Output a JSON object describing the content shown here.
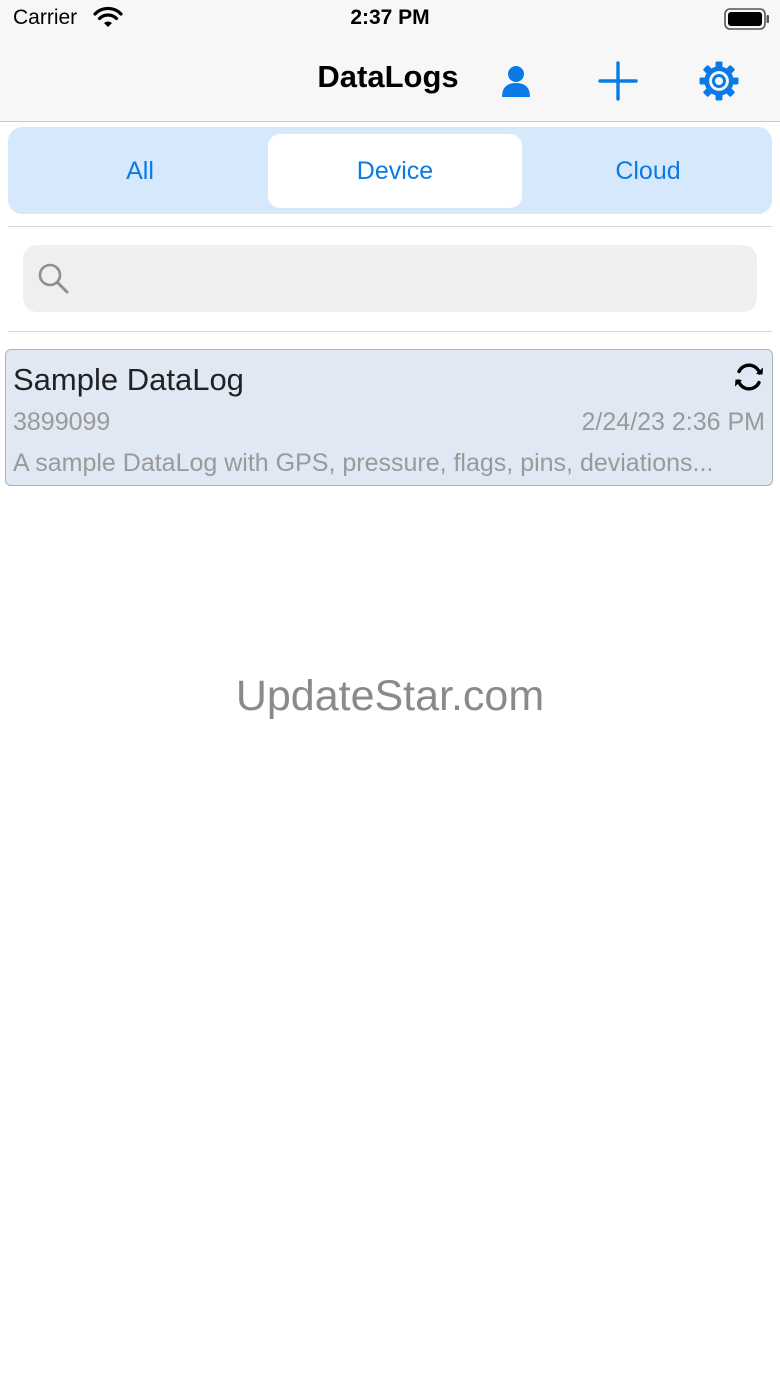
{
  "status_bar": {
    "carrier": "Carrier",
    "time": "2:37 PM",
    "icons": [
      "wifi-icon",
      "battery-icon"
    ]
  },
  "nav": {
    "title": "DataLogs",
    "accent_color": "#0a7be6",
    "buttons": [
      "person-icon",
      "plus-icon",
      "gear-icon"
    ]
  },
  "segments": {
    "items": [
      "All",
      "Device",
      "Cloud"
    ],
    "selected": "Device"
  },
  "search": {
    "value": "",
    "placeholder": ""
  },
  "datalogs": [
    {
      "title": "Sample DataLog",
      "id": "3899099",
      "date": "2/24/23 2:36 PM",
      "description": "A sample DataLog with GPS, pressure, flags, pins, deviations...",
      "icon": "sync-icon"
    }
  ],
  "watermark": "UpdateStar.com"
}
